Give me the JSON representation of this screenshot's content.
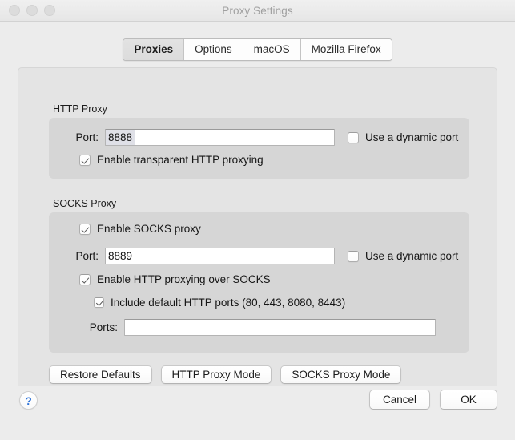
{
  "window": {
    "title": "Proxy Settings",
    "traffic_lights": [
      "close",
      "minimize",
      "zoom"
    ]
  },
  "tabs": [
    {
      "label": "Proxies",
      "selected": true
    },
    {
      "label": "Options",
      "selected": false
    },
    {
      "label": "macOS",
      "selected": false
    },
    {
      "label": "Mozilla Firefox",
      "selected": false
    }
  ],
  "http_proxy": {
    "group_label": "HTTP Proxy",
    "port_label": "Port:",
    "port_value": "8888",
    "port_placeholder": "",
    "dynamic_port_label": "Use a dynamic port",
    "dynamic_port_checked": false,
    "transparent_label": "Enable transparent HTTP proxying",
    "transparent_checked": true
  },
  "socks_proxy": {
    "group_label": "SOCKS Proxy",
    "enable_label": "Enable SOCKS proxy",
    "enable_checked": true,
    "port_label": "Port:",
    "port_value": "8889",
    "port_placeholder": "",
    "dynamic_port_label": "Use a dynamic port",
    "dynamic_port_checked": false,
    "http_over_socks_label": "Enable HTTP proxying over SOCKS",
    "http_over_socks_checked": true,
    "include_defaults_label": "Include default HTTP ports (80, 443, 8080, 8443)",
    "include_defaults_checked": true,
    "ports_label": "Ports:",
    "ports_value": "",
    "ports_placeholder": ""
  },
  "mode_buttons": {
    "restore_defaults": "Restore Defaults",
    "http_proxy_mode": "HTTP Proxy Mode",
    "socks_proxy_mode": "SOCKS Proxy Mode"
  },
  "footer": {
    "help": "?",
    "cancel": "Cancel",
    "ok": "OK"
  },
  "colors": {
    "window_bg": "#ececec",
    "tabpanel_bg": "#e4e4e4",
    "groupbox_bg": "#d6d6d6",
    "title_text": "#a0a0a0",
    "help_blue": "#2d72d9",
    "selection_highlight": "#dfe0e7"
  }
}
